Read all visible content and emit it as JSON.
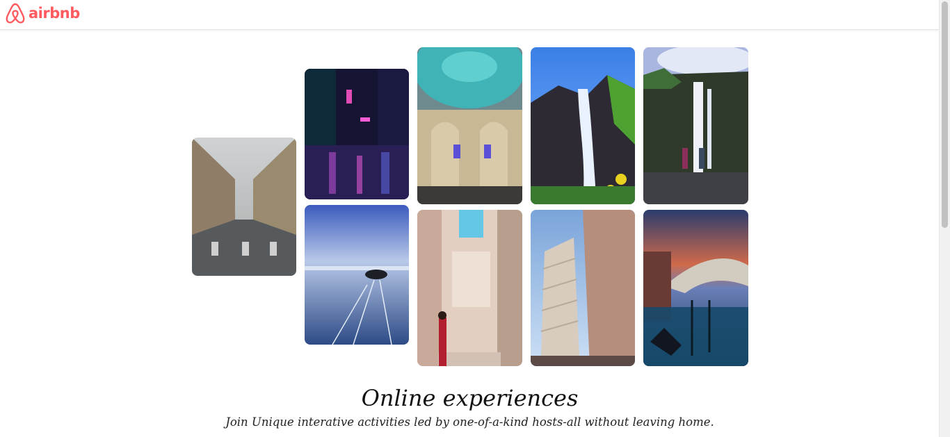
{
  "header": {
    "logo_text": "airbnb",
    "logo_icon": "airbnb-belo-icon",
    "brand_color": "#FF5A5F"
  },
  "gallery": {
    "photos": [
      {
        "name": "empty-city-street-photo"
      },
      {
        "name": "neon-rainy-street-photo"
      },
      {
        "name": "frozen-lake-hovercraft-photo"
      },
      {
        "name": "mosque-interior-dome-photo"
      },
      {
        "name": "italian-alley-woman-photo"
      },
      {
        "name": "mountain-waterfall-photo"
      },
      {
        "name": "leaning-tower-pisa-photo"
      },
      {
        "name": "waterfall-couple-photo"
      },
      {
        "name": "venice-rialto-bridge-photo"
      }
    ]
  },
  "hero": {
    "title": "Online experiences",
    "subtitle": "Join Unique interative activities led by one-of-a-kind hosts-all without leaving home."
  }
}
